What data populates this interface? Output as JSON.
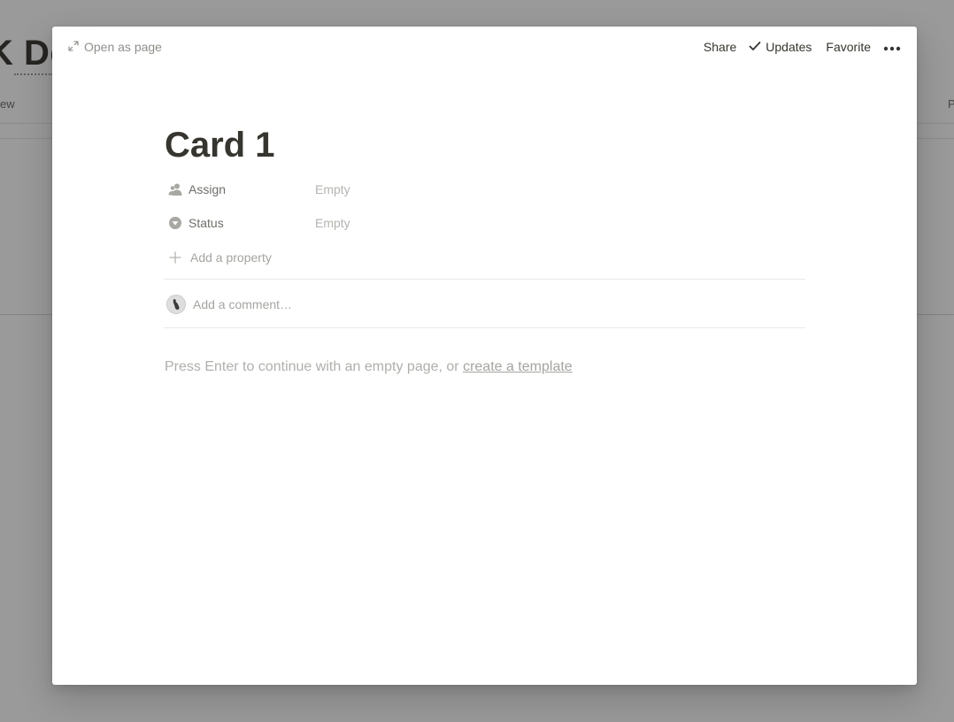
{
  "background": {
    "title_fragment": "K De",
    "tab_left_fragment": "ew",
    "tab_right_fragment": "P"
  },
  "topbar": {
    "open_as_page": "Open as page",
    "share": "Share",
    "updates": "Updates",
    "favorite": "Favorite",
    "more_icon": "ellipsis-icon"
  },
  "page": {
    "title": "Card 1",
    "properties": [
      {
        "name": "Assign",
        "value": "Empty",
        "icon": "person-icon"
      },
      {
        "name": "Status",
        "value": "Empty",
        "icon": "select-icon"
      }
    ],
    "add_property": "Add a property",
    "comment_placeholder": "Add a comment…",
    "hint_text": "Press Enter to continue with an empty page, or ",
    "hint_link": "create a template"
  }
}
